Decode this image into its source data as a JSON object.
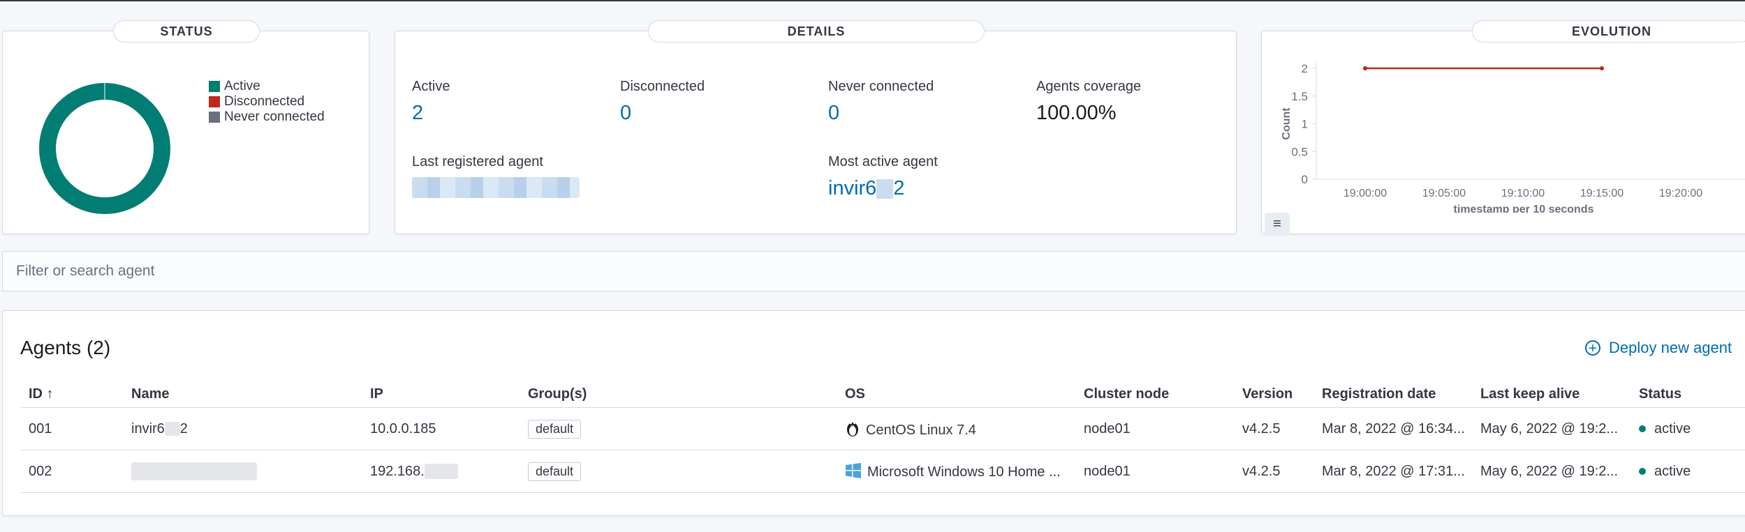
{
  "status_panel": {
    "title": "STATUS",
    "legend": [
      {
        "label": "Active",
        "color": "#017d73"
      },
      {
        "label": "Disconnected",
        "color": "#bd271e"
      },
      {
        "label": "Never connected",
        "color": "#69707d"
      }
    ]
  },
  "details_panel": {
    "title": "DETAILS",
    "stats": [
      {
        "label": "Active",
        "value": "2"
      },
      {
        "label": "Disconnected",
        "value": "0"
      },
      {
        "label": "Never connected",
        "value": "0"
      },
      {
        "label": "Agents coverage",
        "value": "100.00%"
      }
    ],
    "last_registered_label": "Last registered agent",
    "most_active_label": "Most active agent",
    "most_active_prefix": "invir6",
    "most_active_suffix": "2"
  },
  "evolution_panel": {
    "title": "EVOLUTION"
  },
  "chart_data": {
    "type": "line",
    "x": [
      "19:00:00",
      "19:15:00"
    ],
    "series": [
      {
        "values": [
          2,
          2
        ],
        "color": "#bd271e"
      }
    ],
    "x_ticks": [
      "19:00:00",
      "19:05:00",
      "19:10:00",
      "19:15:00",
      "19:20:00"
    ],
    "y_ticks": [
      "2",
      "1.5",
      "1",
      "0.5",
      "0"
    ],
    "ylim": [
      0,
      2
    ],
    "xlabel": "timestamp per 10 seconds",
    "ylabel": "Count"
  },
  "search": {
    "placeholder": "Filter or search agent"
  },
  "agents": {
    "title": "Agents (2)",
    "deploy_label": "Deploy new agent",
    "columns": [
      "ID ↑",
      "Name",
      "IP",
      "Group(s)",
      "OS",
      "Cluster node",
      "Version",
      "Registration date",
      "Last keep alive",
      "Status"
    ],
    "rows": [
      {
        "id": "001",
        "name": "invir6",
        "name_suffix": "2",
        "ip": "10.0.0.185",
        "group": "default",
        "os": "CentOS Linux 7.4",
        "node": "node01",
        "version": "v4.2.5",
        "registered": "Mar 8, 2022 @ 16:34...",
        "keepalive": "May 6, 2022 @ 19:2...",
        "status": "active"
      },
      {
        "id": "002",
        "name": "",
        "ip": "192.168.",
        "group": "default",
        "os": "Microsoft Windows 10 Home ...",
        "node": "node01",
        "version": "v4.2.5",
        "registered": "Mar 8, 2022 @ 17:31...",
        "keepalive": "May 6, 2022 @ 19:2...",
        "status": "active"
      }
    ]
  }
}
